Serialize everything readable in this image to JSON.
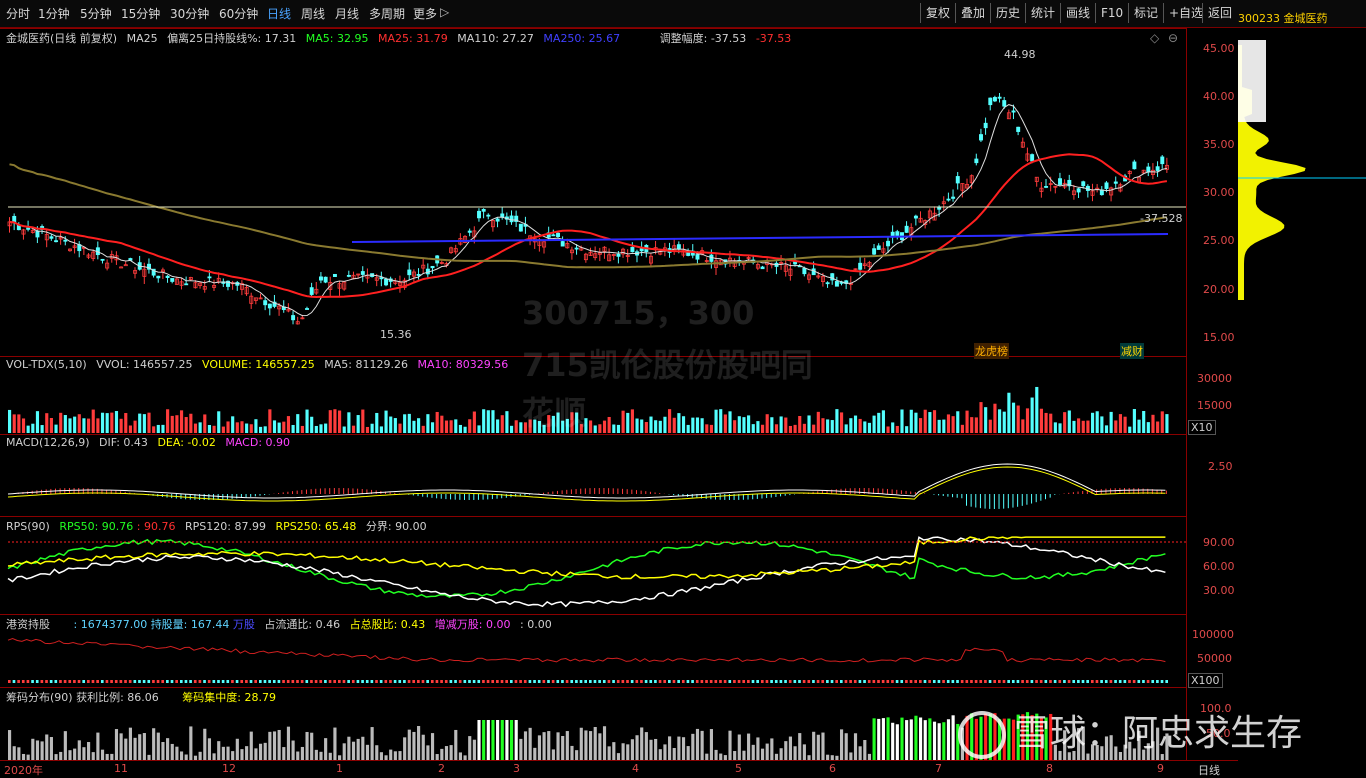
{
  "toolbar": {
    "periods": [
      "分时",
      "1分钟",
      "5分钟",
      "15分钟",
      "30分钟",
      "60分钟",
      "日线",
      "周线",
      "月线",
      "多周期",
      "更多"
    ],
    "active_index": 6,
    "more_arrow": "▷",
    "buttons": [
      "复权",
      "叠加",
      "历史",
      "统计",
      "画线",
      "F10",
      "标记",
      "+自选",
      "返回"
    ],
    "stock_code_name": "300233 金城医药"
  },
  "main_panel": {
    "title": "金城医药(日线 前复权)",
    "ma_label": "MA25",
    "bias_label": "偏离25日持股线%: 17.31",
    "ma5": "MA5: 32.95",
    "ma25": "MA25: 31.79",
    "ma110": "MA110: 27.27",
    "ma250": "MA250: 25.67",
    "adjust": "调整幅度: -37.53",
    "adjust2": "-37.53",
    "y_ticks": [
      "45.00",
      "40.00",
      "35.00",
      "30.00",
      "25.00",
      "20.00",
      "15.00"
    ],
    "high_label": "44.98",
    "low_label": "15.36",
    "right_label": "-37.528",
    "event1": "龙虎榜",
    "event2": "减财"
  },
  "vol_panel": {
    "title": "VOL-TDX(5,10)",
    "vvol": "VVOL: 146557.25",
    "volume": "VOLUME: 146557.25",
    "ma5": "MA5: 81129.26",
    "ma10": "MA10: 80329.56",
    "y_ticks": [
      "30000",
      "15000"
    ],
    "unit": "X10"
  },
  "macd_panel": {
    "title": "MACD(12,26,9)",
    "dif": "DIF: 0.43",
    "dea": "DEA: -0.02",
    "macd": "MACD: 0.90",
    "y_ticks": [
      "2.50"
    ]
  },
  "rps_panel": {
    "title": "RPS(90)",
    "rps50": "RPS50: 90.76",
    "rps50b": ": 90.76",
    "rps120": "RPS120: 87.99",
    "rps250": "RPS250: 65.48",
    "boundary": "分界: 90.00",
    "y_ticks": [
      "90.00",
      "60.00",
      "30.00"
    ]
  },
  "hk_panel": {
    "title": "港资持股",
    "v1": ": 1674377.00",
    "hold": "持股量: 167.44",
    "unit": "万股",
    "float_ratio": "占流通比: 0.46",
    "total_ratio": "占总股比: 0.43",
    "change": "增减万股: 0.00",
    "extra": ": 0.00",
    "y_ticks": [
      "100000",
      "50000"
    ],
    "scale": "X100"
  },
  "chip_panel": {
    "title": "筹码分布(90)",
    "profit": "获利比例: 86.06",
    "concentration": "筹码集中度: 28.79",
    "y_ticks": [
      "100.0",
      "50.0"
    ]
  },
  "x_axis": {
    "labels": [
      "2020年",
      "11",
      "12",
      "1",
      "2",
      "3",
      "4",
      "5",
      "6",
      "7",
      "8",
      "9"
    ],
    "period_label": "日线"
  },
  "watermarks": {
    "line1": "300715，300",
    "line2": "715凯伦股份股吧同",
    "line3": "花顺",
    "brand": "雪球：阿忠求生存"
  },
  "colors": {
    "up": "#ff3c3c",
    "down": "#54ffff",
    "ma5": "#ffffff",
    "ma25": "#ff2020",
    "ma110": "#8a7a30",
    "ma250": "#2b2bff",
    "yellow": "#ffff00",
    "green": "#22ff22",
    "magenta": "#ff44ff"
  }
}
